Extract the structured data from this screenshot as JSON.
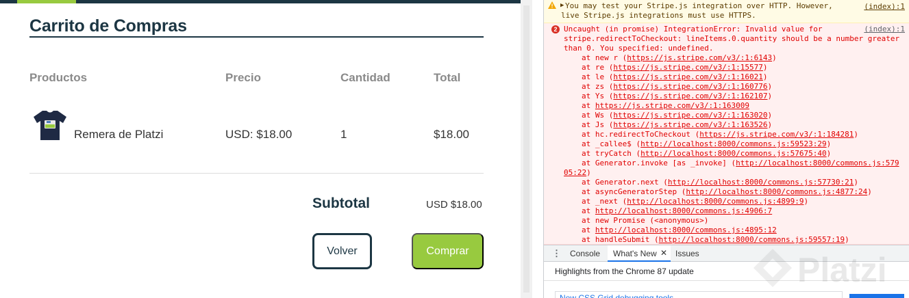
{
  "cart": {
    "title": "Carrito de Compras",
    "headers": {
      "product": "Productos",
      "price": "Precio",
      "quantity": "Cantidad",
      "total": "Total"
    },
    "item": {
      "name": "Remera de Platzi",
      "price": "USD: $18.00",
      "quantity": "1",
      "total": "$18.00"
    },
    "subtotal_label": "Subtotal",
    "subtotal_value": "USD $18.00",
    "back_label": "Volver",
    "buy_label": "Comprar",
    "colors": {
      "brand_dark": "#1c3643",
      "brand_green": "#98ca3f"
    }
  },
  "console": {
    "warning": {
      "lines": [
        "You may test your Stripe.js integration over HTTP. However,",
        "live Stripe.js integrations must use HTTPS."
      ],
      "source": "(index):1"
    },
    "error": {
      "badge": "2",
      "lines": [
        "Uncaught (in promise) IntegrationError: Invalid value for",
        "stripe.redirectToCheckout: lineItems.0.quantity should be a number greater",
        "than 0. You specified: undefined."
      ],
      "source": "(index):1",
      "stack": [
        {
          "prefix": "at new r (",
          "link": "https://js.stripe.com/v3/:1:6143",
          "suffix": ")"
        },
        {
          "prefix": "at re (",
          "link": "https://js.stripe.com/v3/:1:15577",
          "suffix": ")"
        },
        {
          "prefix": "at le (",
          "link": "https://js.stripe.com/v3/:1:16021",
          "suffix": ")"
        },
        {
          "prefix": "at zs (",
          "link": "https://js.stripe.com/v3/:1:160776",
          "suffix": ")"
        },
        {
          "prefix": "at Ys (",
          "link": "https://js.stripe.com/v3/:1:162107",
          "suffix": ")"
        },
        {
          "prefix": "at ",
          "link": "https://js.stripe.com/v3/:1:163009",
          "suffix": ""
        },
        {
          "prefix": "at Ws (",
          "link": "https://js.stripe.com/v3/:1:163020",
          "suffix": ")"
        },
        {
          "prefix": "at Js (",
          "link": "https://js.stripe.com/v3/:1:163526",
          "suffix": ")"
        },
        {
          "prefix": "at hc.redirectToCheckout (",
          "link": "https://js.stripe.com/v3/:1:184281",
          "suffix": ")"
        },
        {
          "prefix": "at _callee$ (",
          "link": "http://localhost:8000/commons.js:59523:29",
          "suffix": ")"
        },
        {
          "prefix": "at tryCatch (",
          "link": "http://localhost:8000/commons.js:57675:40",
          "suffix": ")"
        },
        {
          "prefix": "at Generator.invoke [as _invoke] (",
          "link": "http://localhost:8000/commons.js:579",
          "suffix": ""
        },
        {
          "prefix": "",
          "link": "05:22",
          "suffix": ")",
          "wrap": true
        },
        {
          "prefix": "at Generator.next (",
          "link": "http://localhost:8000/commons.js:57730:21",
          "suffix": ")"
        },
        {
          "prefix": "at asyncGeneratorStep (",
          "link": "http://localhost:8000/commons.js:4877:24",
          "suffix": ")"
        },
        {
          "prefix": "at _next (",
          "link": "http://localhost:8000/commons.js:4899:9",
          "suffix": ")"
        },
        {
          "prefix": "at ",
          "link": "http://localhost:8000/commons.js:4906:7",
          "suffix": ""
        },
        {
          "prefix": "at new Promise (<anonymous>)",
          "link": "",
          "suffix": ""
        },
        {
          "prefix": "at ",
          "link": "http://localhost:8000/commons.js:4895:12",
          "suffix": ""
        },
        {
          "prefix": "at handleSubmit (",
          "link": "http://localhost:8000/commons.js:59557:19",
          "suffix": ")"
        }
      ]
    }
  },
  "drawer": {
    "tabs": {
      "console": "Console",
      "whats_new": "What's New",
      "issues": "Issues"
    },
    "highlights": "Highlights from the Chrome 87 update",
    "card_text": "New CSS Grid debugging tools"
  },
  "watermark": {
    "text": "Platzi"
  }
}
